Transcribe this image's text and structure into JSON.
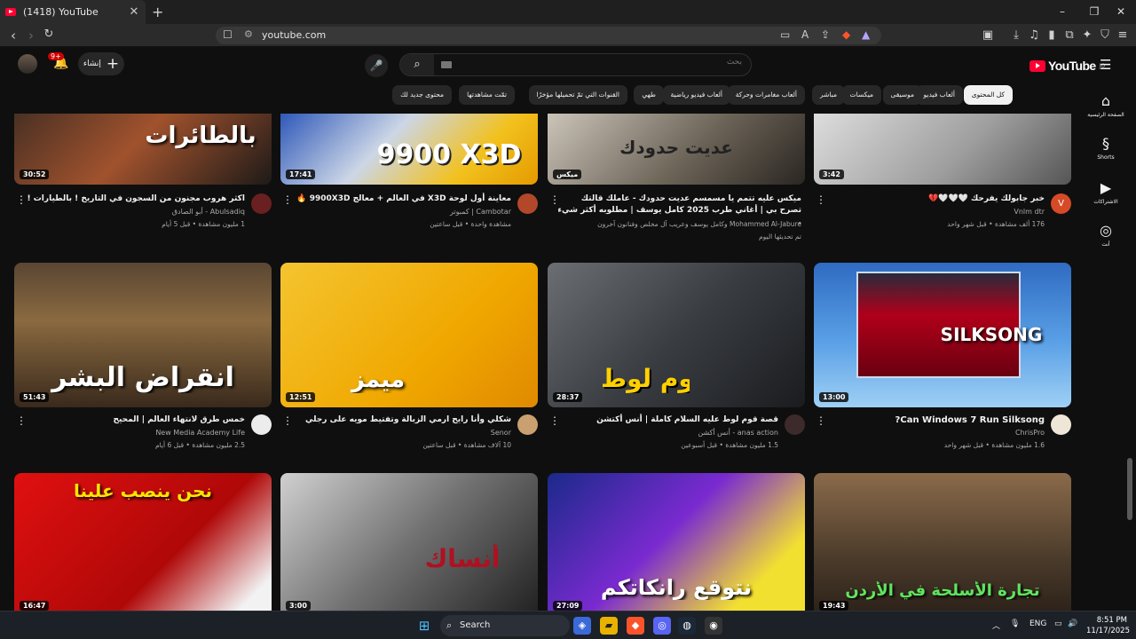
{
  "browser": {
    "tab_title": "(1418) YouTube",
    "new_tab": "+",
    "url": "youtube.com",
    "window_controls": [
      "–",
      "❐",
      "✕"
    ]
  },
  "youtube_header": {
    "logo_text": "YouTube",
    "logo_region": "JO",
    "search_placeholder": "بحث",
    "create_label": "إنشاء",
    "notifications_badge": "9+"
  },
  "chips": [
    {
      "label": "كل المحتوى",
      "active": true
    },
    {
      "label": "ألعاب فيديو"
    },
    {
      "label": "موسيقى"
    },
    {
      "label": "ميكسات"
    },
    {
      "label": "مباشر"
    },
    {
      "label": "ألعاب مغامرات وحركة"
    },
    {
      "label": "ألعاب فيديو رياضية"
    },
    {
      "label": "طهي"
    },
    {
      "label": "القنوات التي تمّ تحميلها مؤخرًا"
    },
    {
      "label": "تمّت مشاهدتها"
    },
    {
      "label": "محتوى جديد لك"
    }
  ],
  "rail": [
    {
      "label": "الصفحة الرئيسية",
      "icon": "home-icon"
    },
    {
      "label": "Shorts",
      "icon": "shorts-icon"
    },
    {
      "label": "الاشتراكات",
      "icon": "subscriptions-icon"
    },
    {
      "label": "أنت",
      "icon": "you-icon"
    }
  ],
  "videos": [
    {
      "title": "خبر جابولك يفرحك 🤍🤍🤍💔",
      "channel": "Vnlm dtr",
      "stats": "176 ألف مشاهدة • قبل شهر واحد",
      "duration": "3:42",
      "overlay": "",
      "avatar_letter": "V"
    },
    {
      "title": "ميكس عليه تتمم يا مسمسم عديت حدودك - عاملك قالتك تصرح بي | أغاني طرب 2025 كامل يوسف | مطلوبه أكثر شيء .",
      "channel": "Mohammed Al-Jabure وكامل يوسف وعريب آل مخلص وفنانون آخرون",
      "stats": "تم تحديثها اليوم",
      "duration": "ميكس",
      "overlay": "عديت حدودك",
      "avatar_letter": ""
    },
    {
      "title": "معاينة أول لوحة X3D في العالم + معالج 9900X3D 🔥",
      "channel": "Cambotar | كمبوتر",
      "stats": "مشاهدة واحدة • قبل ساعتين",
      "duration": "17:41",
      "overlay": "9900 X3D",
      "avatar_letter": ""
    },
    {
      "title": "اكثر هروب مجنون من السجون في التاريخ ! بالطيارات !",
      "channel": "Abulsadiq - أبو الصادق",
      "stats": "1 مليون مشاهدة • قبل 5 أيام",
      "duration": "30:52",
      "overlay": "بالطائرات",
      "avatar_letter": ""
    },
    {
      "title": "Can Windows 7 Run Silksong?",
      "channel": "ChrisPro",
      "stats": "1.6 مليون مشاهدة • قبل شهر واحد",
      "duration": "13:00",
      "overlay": "SILKSONG",
      "avatar_letter": ""
    },
    {
      "title": "قصة قوم لوط عليه السلام كاملة | أنس أكتشن",
      "channel": "anas action - أنس أكشن",
      "stats": "1.5 مليون مشاهدة • قبل أسبوعين",
      "duration": "28:37",
      "overlay": "قوم لوط",
      "avatar_letter": ""
    },
    {
      "title": "شكلي وأنا رايح ارمي الزبالة وتفتيط مويه على رجلي",
      "channel": "Senor",
      "stats": "10 آلاف مشاهدة • قبل ساعتين",
      "duration": "12:51",
      "overlay": "ميمز",
      "avatar_letter": ""
    },
    {
      "title": "خمس طرق لانتهاء العالم | المحيح",
      "channel": "New Media Academy Life",
      "stats": "2.5 مليون مشاهدة • قبل 6 أيام",
      "duration": "51:43",
      "overlay": "انقراض البشر",
      "avatar_letter": ""
    },
    {
      "title": "",
      "channel": "",
      "stats": "",
      "duration": "19:43",
      "overlay": "تجارة الأسلحة في الأردن",
      "avatar_letter": ""
    },
    {
      "title": "",
      "channel": "",
      "stats": "",
      "duration": "27:09",
      "overlay": "نتوقع رانكاتكم",
      "avatar_letter": ""
    },
    {
      "title": "",
      "channel": "",
      "stats": "",
      "duration": "3:00",
      "overlay": "أنساك",
      "avatar_letter": ""
    },
    {
      "title": "",
      "channel": "",
      "stats": "",
      "duration": "16:47",
      "overlay": "نحن ينصب علينا",
      "avatar_letter": ""
    }
  ],
  "taskbar": {
    "search_label": "Search",
    "lang": "ENG",
    "time": "8:51 PM",
    "date": "11/17/2025"
  }
}
